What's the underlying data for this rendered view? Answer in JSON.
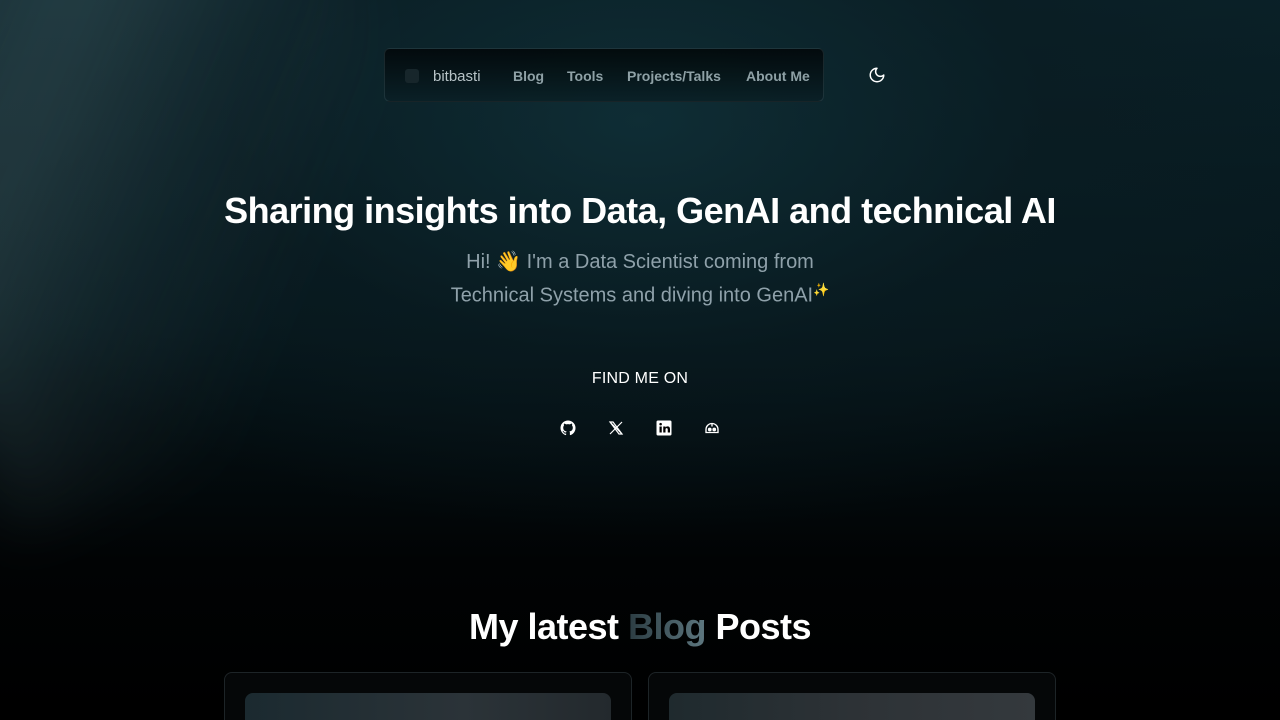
{
  "nav": {
    "logo_text": "bitbasti",
    "items": [
      {
        "label": "Blog"
      },
      {
        "label": "Tools"
      },
      {
        "label": "Projects/Talks"
      },
      {
        "label": "About Me"
      }
    ],
    "theme_toggle_icon": "moon-icon"
  },
  "hero": {
    "title": "Sharing insights into Data, GenAI and technical AI",
    "subtitle_line1": "Hi! 👋 I'm a Data Scientist coming from",
    "subtitle_line2": "Technical Systems and diving into GenAI",
    "subtitle_sparkle": "✨"
  },
  "social": {
    "label": "FIND ME ON",
    "icons": [
      "github-icon",
      "x-icon",
      "linkedin-icon",
      "helmet-icon"
    ]
  },
  "blog": {
    "title_prefix": "My latest ",
    "title_accent": "Blog",
    "title_suffix": " Posts"
  },
  "colors": {
    "background": "#000000",
    "nav_text": "#8fa1a6",
    "subtitle_text": "#8fa1aa",
    "accent_gradient_start": "#2b3c42",
    "accent_gradient_end": "#5e7880"
  }
}
